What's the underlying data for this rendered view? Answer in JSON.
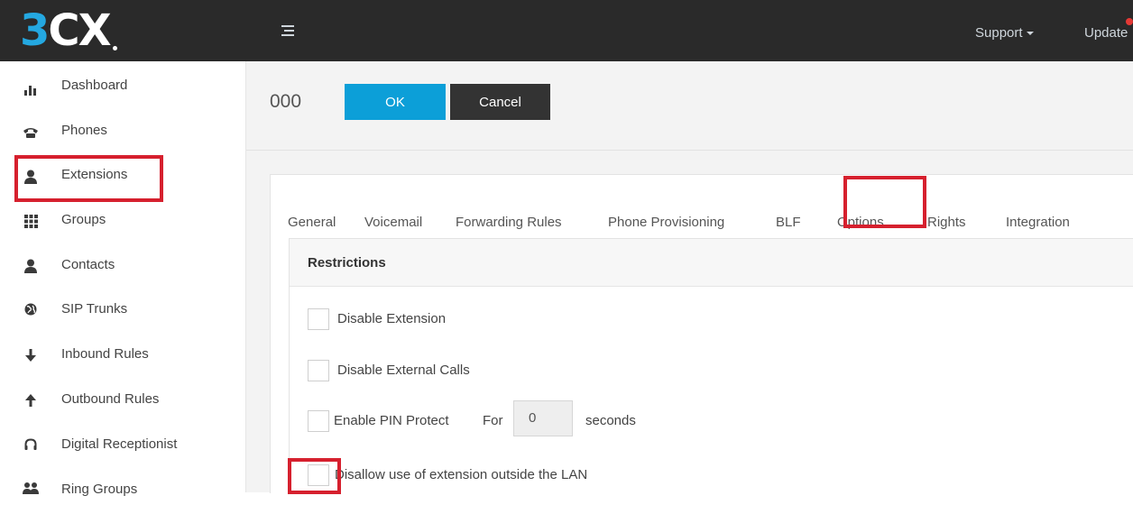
{
  "app": {
    "logo_text_3": "3",
    "logo_text_cx": "CX"
  },
  "topbar": {
    "menu_icon": "list-icon",
    "links": [
      {
        "label": "Support",
        "has_dropdown": true
      },
      {
        "label": "Update"
      }
    ]
  },
  "sidebar": {
    "items": [
      {
        "label": "Dashboard",
        "icon": "bar-chart-icon"
      },
      {
        "label": "Phones",
        "icon": "phone-icon"
      },
      {
        "label": "Extensions",
        "icon": "user-icon"
      },
      {
        "label": "Groups",
        "icon": "grid-icon"
      },
      {
        "label": "Contacts",
        "icon": "user-icon"
      },
      {
        "label": "SIP Trunks",
        "icon": "globe-icon"
      },
      {
        "label": "Inbound Rules",
        "icon": "arrow-down-icon"
      },
      {
        "label": "Outbound Rules",
        "icon": "arrow-up-icon"
      },
      {
        "label": "Digital Receptionist",
        "icon": "headset-icon"
      },
      {
        "label": "Ring Groups",
        "icon": "users-icon"
      }
    ]
  },
  "header": {
    "extension_number": "000",
    "ok_label": "OK",
    "cancel_label": "Cancel"
  },
  "tabs": [
    {
      "label": "General"
    },
    {
      "label": "Voicemail"
    },
    {
      "label": "Forwarding Rules"
    },
    {
      "label": "Phone Provisioning"
    },
    {
      "label": "BLF"
    },
    {
      "label": "Options",
      "active": true
    },
    {
      "label": "Rights"
    },
    {
      "label": "Integration"
    }
  ],
  "restrictions": {
    "title": "Restrictions",
    "disable_extension": "Disable Extension",
    "disable_external_calls": "Disable External Calls",
    "enable_pin_protect": "Enable PIN Protect",
    "for_label": "For",
    "pin_value": "0",
    "seconds_label": "seconds",
    "disallow_outside_lan": "Disallow use of extension outside the LAN"
  },
  "colors": {
    "topbar_bg": "#2a2a2a",
    "accent_blue": "#0c9fd8",
    "highlight_red": "#d6202e"
  }
}
